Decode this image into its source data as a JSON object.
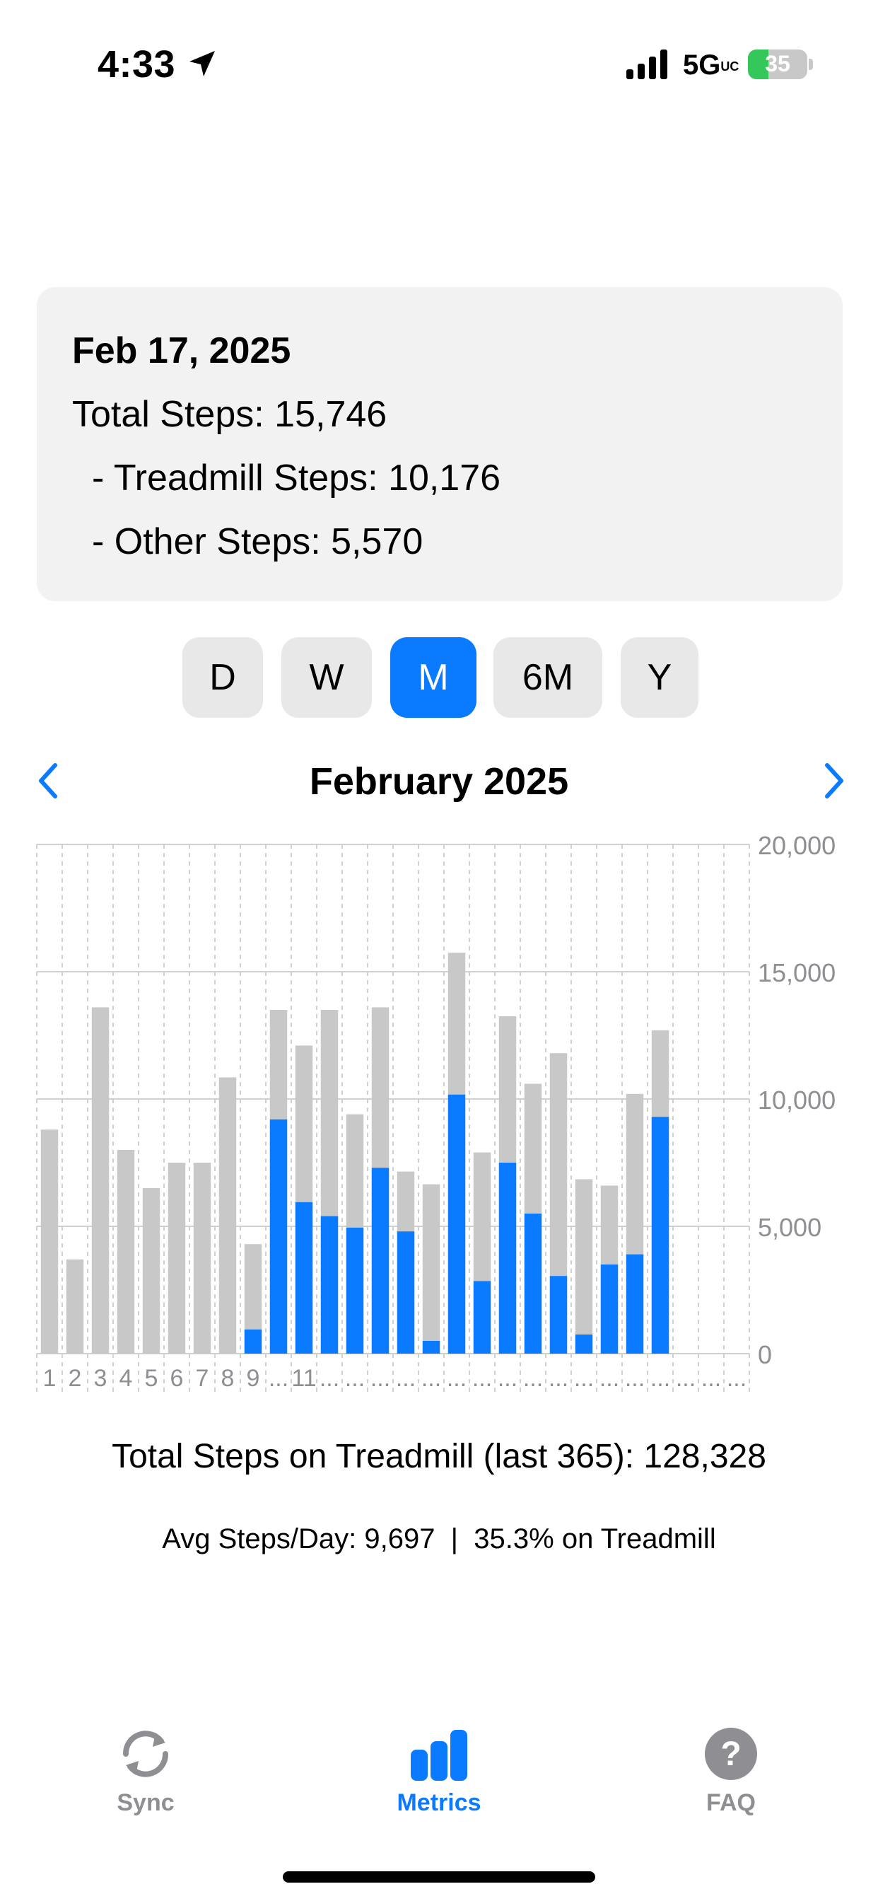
{
  "status_bar": {
    "time": "4:33",
    "network": "5G",
    "network_suffix": "UC",
    "battery": "35",
    "battery_level": 0.35
  },
  "summary": {
    "date": "Feb 17, 2025",
    "total": "Total Steps: 15,746",
    "treadmill": "- Treadmill Steps: 10,176",
    "other": "- Other Steps: 5,570"
  },
  "periods": [
    {
      "label": "D",
      "active": false
    },
    {
      "label": "W",
      "active": false
    },
    {
      "label": "M",
      "active": true
    },
    {
      "label": "6M",
      "active": false
    },
    {
      "label": "Y",
      "active": false
    }
  ],
  "nav": {
    "month_title": "February 2025"
  },
  "colors": {
    "accent": "#0a7aff",
    "other_bar": "#c8c8c8",
    "treadmill_bar": "#0a7aff",
    "inactive_tab": "#8e8e93"
  },
  "chart_data": {
    "type": "bar",
    "stacked": true,
    "grid": true,
    "ylim": [
      0,
      20000
    ],
    "yticks": [
      "0",
      "5,000",
      "10,000",
      "15,000",
      "20,000"
    ],
    "ytick_values": [
      0,
      5000,
      10000,
      15000,
      20000
    ],
    "categories": [
      "1",
      "2",
      "3",
      "4",
      "5",
      "6",
      "7",
      "8",
      "9",
      "10",
      "11",
      "12",
      "13",
      "14",
      "15",
      "16",
      "17",
      "18",
      "19",
      "20",
      "21",
      "22",
      "23",
      "24",
      "25",
      "26",
      "27",
      "28"
    ],
    "tick_labels": [
      "1",
      "2",
      "3",
      "4",
      "5",
      "6",
      "7",
      "8",
      "9",
      "...",
      "11",
      "...",
      "...",
      "...",
      "...",
      "...",
      "...",
      "...",
      "...",
      "...",
      "...",
      "...",
      "...",
      "...",
      "...",
      "...",
      "...",
      "..."
    ],
    "series": [
      {
        "name": "Treadmill",
        "color": "#0a7aff",
        "values": [
          0,
          0,
          0,
          0,
          0,
          0,
          0,
          0,
          950,
          9200,
          5950,
          5400,
          4950,
          7300,
          4800,
          500,
          10176,
          2850,
          7500,
          5500,
          3050,
          750,
          3500,
          3900,
          9300,
          0,
          0,
          0
        ]
      },
      {
        "name": "Other",
        "color": "#c8c8c8",
        "values": [
          8800,
          3700,
          13600,
          8000,
          6500,
          7500,
          7500,
          10850,
          3350,
          4300,
          6150,
          8100,
          4450,
          6300,
          2350,
          6150,
          5570,
          5050,
          5750,
          5100,
          8750,
          6100,
          3100,
          6300,
          3400,
          0,
          0,
          0
        ]
      }
    ]
  },
  "stats": {
    "total_treadmill": "Total Steps on Treadmill (last 365): 128,328",
    "avg_line": "Avg Steps/Day: 9,697  |  35.3% on Treadmill"
  },
  "tabbar": [
    {
      "label": "Sync",
      "icon": "sync-icon",
      "active": false
    },
    {
      "label": "Metrics",
      "icon": "metrics-icon",
      "active": true
    },
    {
      "label": "FAQ",
      "icon": "faq-icon",
      "active": false
    }
  ]
}
